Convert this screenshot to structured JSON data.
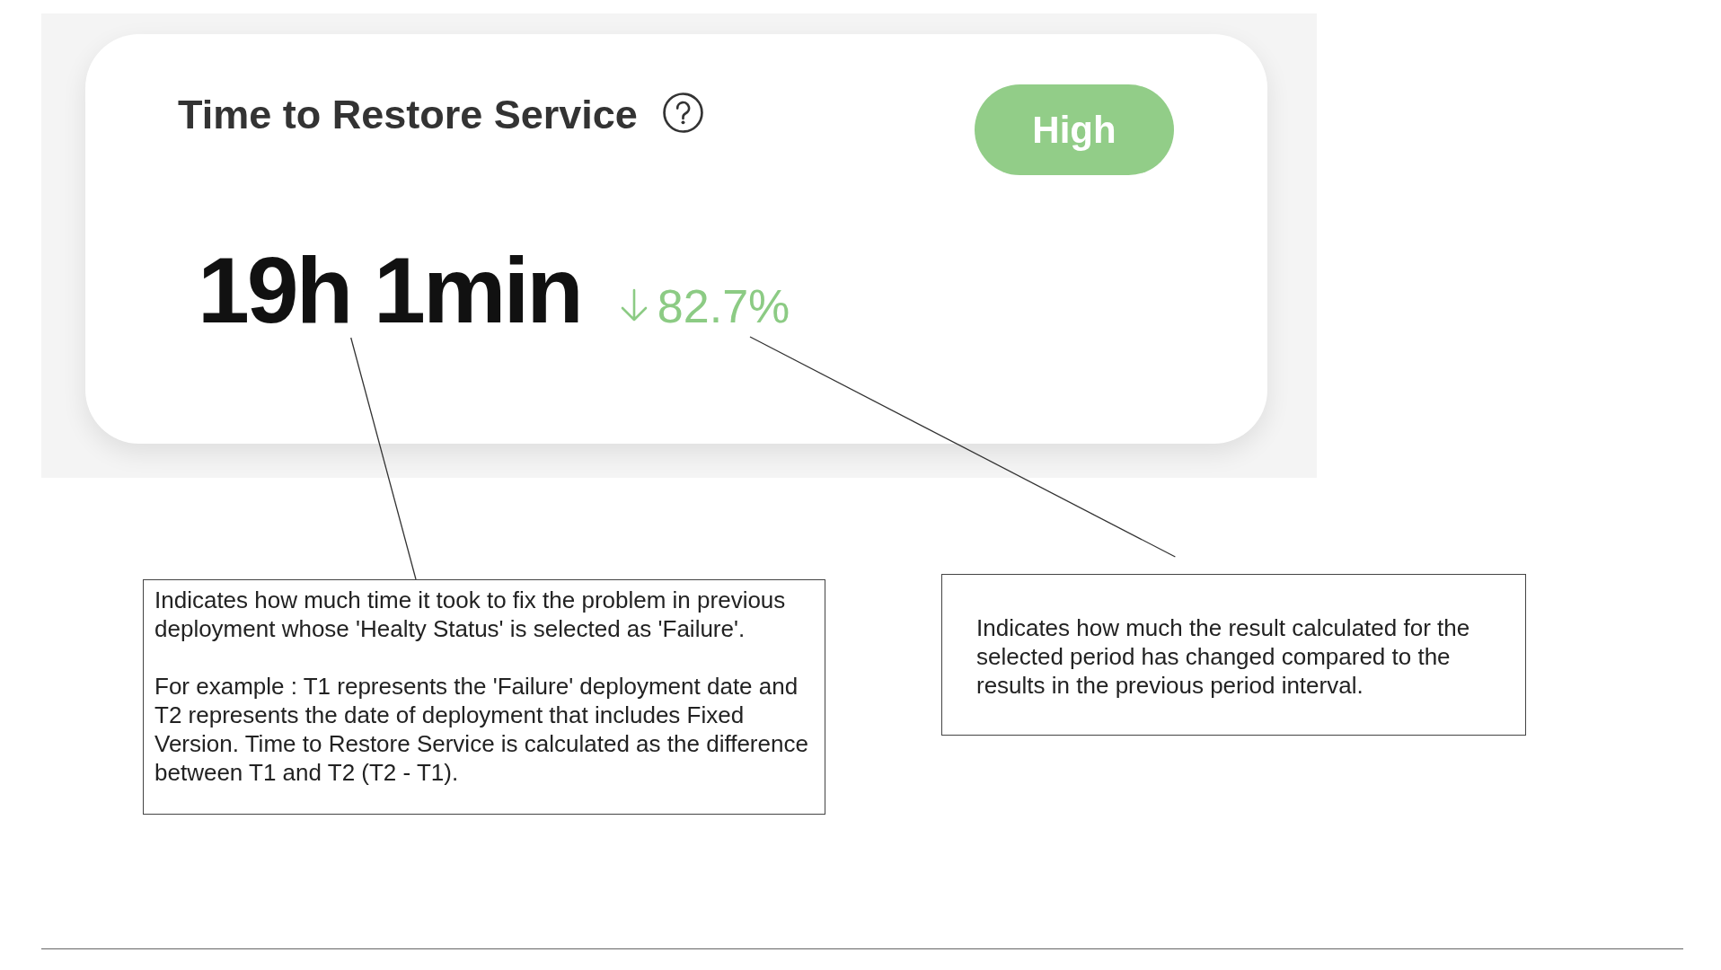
{
  "metric_card": {
    "title": "Time to Restore Service",
    "badge": {
      "label": "High"
    },
    "value": "19h 1min",
    "change": {
      "text": "82.7%",
      "decreased": true
    }
  },
  "notes": [
    {
      "kind": "value",
      "paragraphs": [
        "Indicates how much time it took to fix the problem in previous deployment whose 'Healty Status' is selected as 'Failure'.",
        "For example : T1 represents the 'Failure' deployment date and T2 represents the date of deployment that includes Fixed Version. Time to Restore Service is calculated as the difference between T1 and T2 (T2 - T1)."
      ]
    },
    {
      "kind": "change",
      "paragraphs": [
        "Indicates how much the result calculated for the selected period has changed compared to the results in the previous period interval."
      ]
    }
  ]
}
